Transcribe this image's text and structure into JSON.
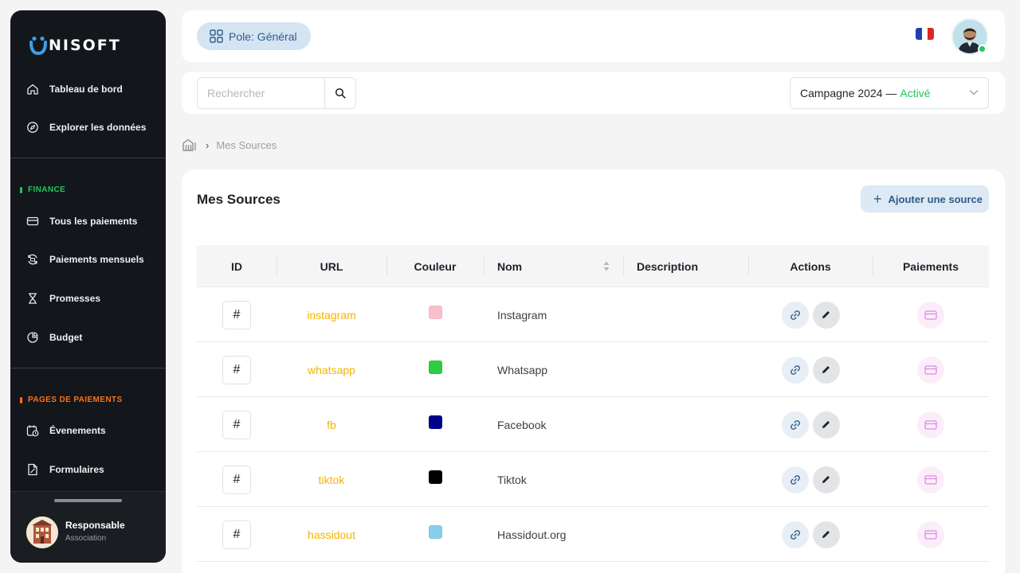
{
  "brand": {
    "logo_text": "NISOFT"
  },
  "sidebar": {
    "items": [
      {
        "label": "Tableau de bord",
        "icon": "home-icon"
      },
      {
        "label": "Explorer les données",
        "icon": "compass-icon"
      },
      {
        "label": "Tous les paiements",
        "icon": "credit-card-icon"
      },
      {
        "label": "Paiements mensuels",
        "icon": "refresh-card-icon"
      },
      {
        "label": "Promesses",
        "icon": "hourglass-icon"
      },
      {
        "label": "Budget",
        "icon": "pie-chart-icon"
      },
      {
        "label": "Évenements",
        "icon": "calendar-clock-icon"
      },
      {
        "label": "Formulaires",
        "icon": "document-icon"
      }
    ],
    "sections": [
      {
        "label": "FINANCE",
        "color": "#22c55e"
      },
      {
        "label": "PAGES DE PAIEMENTS",
        "color": "#f97316"
      }
    ],
    "user": {
      "name": "Responsable",
      "role": "Association"
    }
  },
  "header": {
    "pole_label": "Pole: Général",
    "flag": "france-flag"
  },
  "toolbar": {
    "search_placeholder": "Rechercher",
    "campaign_label": "Campagne 2024 —",
    "campaign_status": "Activé"
  },
  "breadcrumb": {
    "current": "Mes Sources"
  },
  "main": {
    "title": "Mes Sources",
    "add_button": "Ajouter une source",
    "columns": [
      "ID",
      "URL",
      "Couleur",
      "Nom",
      "Description",
      "Actions",
      "Paiements"
    ],
    "rows": [
      {
        "id_symbol": "#",
        "url": "instagram",
        "color": "#f9c0cb",
        "name": "Instagram",
        "description": ""
      },
      {
        "id_symbol": "#",
        "url": "whatsapp",
        "color": "#2ecc40",
        "name": "Whatsapp",
        "description": ""
      },
      {
        "id_symbol": "#",
        "url": "fb",
        "color": "#00008b",
        "name": "Facebook",
        "description": ""
      },
      {
        "id_symbol": "#",
        "url": "tiktok",
        "color": "#000000",
        "name": "Tiktok",
        "description": ""
      },
      {
        "id_symbol": "#",
        "url": "hassidout",
        "color": "#87ceeb",
        "name": "Hassidout.org",
        "description": ""
      }
    ]
  },
  "colors": {
    "accent": "#2f5d8a",
    "url_text": "#f5b400",
    "active": "#22c55e"
  }
}
